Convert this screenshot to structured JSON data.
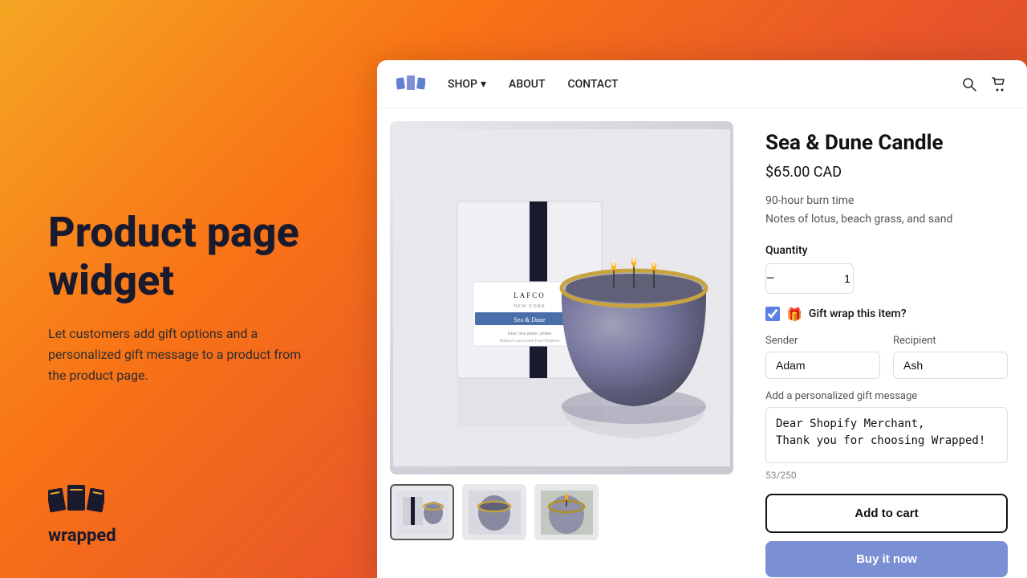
{
  "background": "#f5a623",
  "left_panel": {
    "hero_title": "Product page widget",
    "hero_desc": "Let customers add gift options and a personalized gift message to a product from the product page.",
    "logo_label": "wrapped"
  },
  "nav": {
    "shop_label": "SHOP",
    "about_label": "ABOUT",
    "contact_label": "CONTACT"
  },
  "product": {
    "title": "Sea & Dune Candle",
    "price": "$65.00 CAD",
    "burn_time": "90-hour burn time",
    "notes": "Notes of lotus, beach grass, and sand",
    "quantity_label": "Quantity",
    "quantity_value": "1",
    "gift_wrap_label": "Gift wrap this item?",
    "sender_label": "Sender",
    "sender_value": "Adam",
    "recipient_label": "Recipient",
    "recipient_value": "Ash",
    "gift_message_label": "Add a personalized gift message",
    "gift_message_value": "Dear Shopify Merchant,\nThank you for choosing Wrapped!",
    "char_count": "53/250",
    "add_to_cart_label": "Add to cart",
    "buy_now_label": "Buy it now"
  }
}
